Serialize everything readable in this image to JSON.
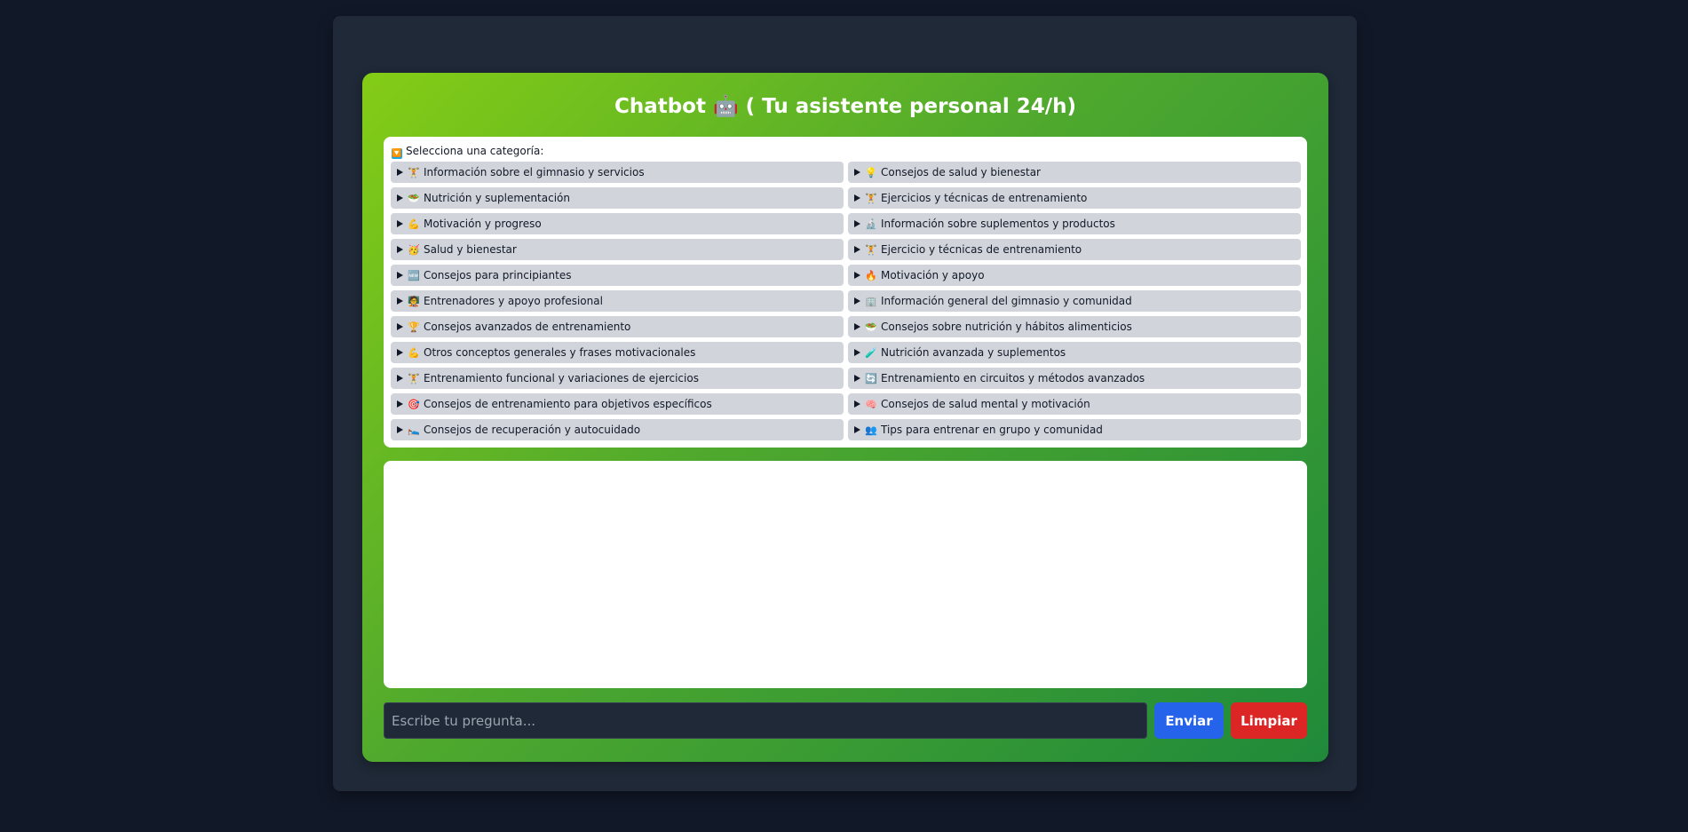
{
  "header": {
    "title": "Chatbot 🤖 ( Tu asistente personal 24/h)"
  },
  "categories": {
    "heading_icon": "🔽",
    "heading": "Selecciona una categoría:",
    "items": [
      {
        "icon": "🏋️",
        "label": "Información sobre el gimnasio y servicios"
      },
      {
        "icon": "💡",
        "label": "Consejos de salud y bienestar"
      },
      {
        "icon": "🥗",
        "label": "Nutrición y suplementación"
      },
      {
        "icon": "🏋️",
        "label": "Ejercicios y técnicas de entrenamiento"
      },
      {
        "icon": "💪",
        "label": "Motivación y progreso"
      },
      {
        "icon": "🔬",
        "label": "Información sobre suplementos y productos"
      },
      {
        "icon": "🥳",
        "label": "Salud y bienestar"
      },
      {
        "icon": "🏋️",
        "label": "Ejercicio y técnicas de entrenamiento"
      },
      {
        "icon": "🆕",
        "label": "Consejos para principiantes"
      },
      {
        "icon": "🔥",
        "label": "Motivación y apoyo"
      },
      {
        "icon": "🧑‍🏫",
        "label": "Entrenadores y apoyo profesional"
      },
      {
        "icon": "🏢",
        "label": "Información general del gimnasio y comunidad"
      },
      {
        "icon": "🏆",
        "label": "Consejos avanzados de entrenamiento"
      },
      {
        "icon": "🥗",
        "label": "Consejos sobre nutrición y hábitos alimenticios"
      },
      {
        "icon": "💪",
        "label": "Otros conceptos generales y frases motivacionales"
      },
      {
        "icon": "🧪",
        "label": "Nutrición avanzada y suplementos"
      },
      {
        "icon": "🏋️",
        "label": "Entrenamiento funcional y variaciones de ejercicios"
      },
      {
        "icon": "🔄",
        "label": "Entrenamiento en circuitos y métodos avanzados"
      },
      {
        "icon": "🎯",
        "label": "Consejos de entrenamiento para objetivos específicos"
      },
      {
        "icon": "🧠",
        "label": "Consejos de salud mental y motivación"
      },
      {
        "icon": "🛌",
        "label": "Consejos de recuperación y autocuidado"
      },
      {
        "icon": "👥",
        "label": "Tips para entrenar en grupo y comunidad"
      }
    ]
  },
  "input": {
    "placeholder": "Escribe tu pregunta...",
    "value": ""
  },
  "buttons": {
    "send_label": "Enviar",
    "clear_label": "Limpiar"
  },
  "colors": {
    "page_bg": "#111827",
    "panel_bg": "#1f2937",
    "gradient_start": "#84cc16",
    "gradient_end": "#1f8a3a",
    "item_bg": "#d1d5db",
    "send_button": "#2563eb",
    "clear_button": "#dc2626"
  }
}
